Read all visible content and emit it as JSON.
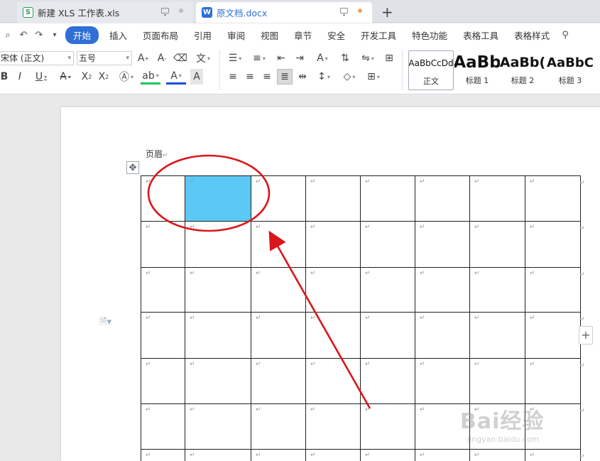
{
  "tabs": [
    {
      "icon": "S",
      "title": "新建 XLS 工作表.xls"
    },
    {
      "icon": "W",
      "title": "原文档.docx"
    }
  ],
  "menu": [
    "开始",
    "插入",
    "页面布局",
    "引用",
    "审阅",
    "视图",
    "章节",
    "安全",
    "开发工具",
    "特色功能",
    "表格工具",
    "表格样式"
  ],
  "font": {
    "name": "宋体 (正文)",
    "size": "五号"
  },
  "styles": [
    {
      "sample": "AaBbCcDd",
      "name": "正文"
    },
    {
      "sample": "AaBb",
      "name": "标题 1"
    },
    {
      "sample": "AaBb(",
      "name": "标题 2"
    },
    {
      "sample": "AaBbC",
      "name": "标题 3"
    }
  ],
  "document": {
    "header_label": "页眉",
    "paragraph_mark": "↵",
    "table": {
      "rows": 7,
      "cols": 8,
      "selected_cell": [
        0,
        1
      ]
    }
  },
  "watermark": {
    "brand": "Bai经验",
    "url": "jingyan.baidu.com"
  },
  "colors": {
    "accent": "#2f6fd6",
    "selection": "#5bc8f5",
    "annotation": "#d9161c"
  }
}
